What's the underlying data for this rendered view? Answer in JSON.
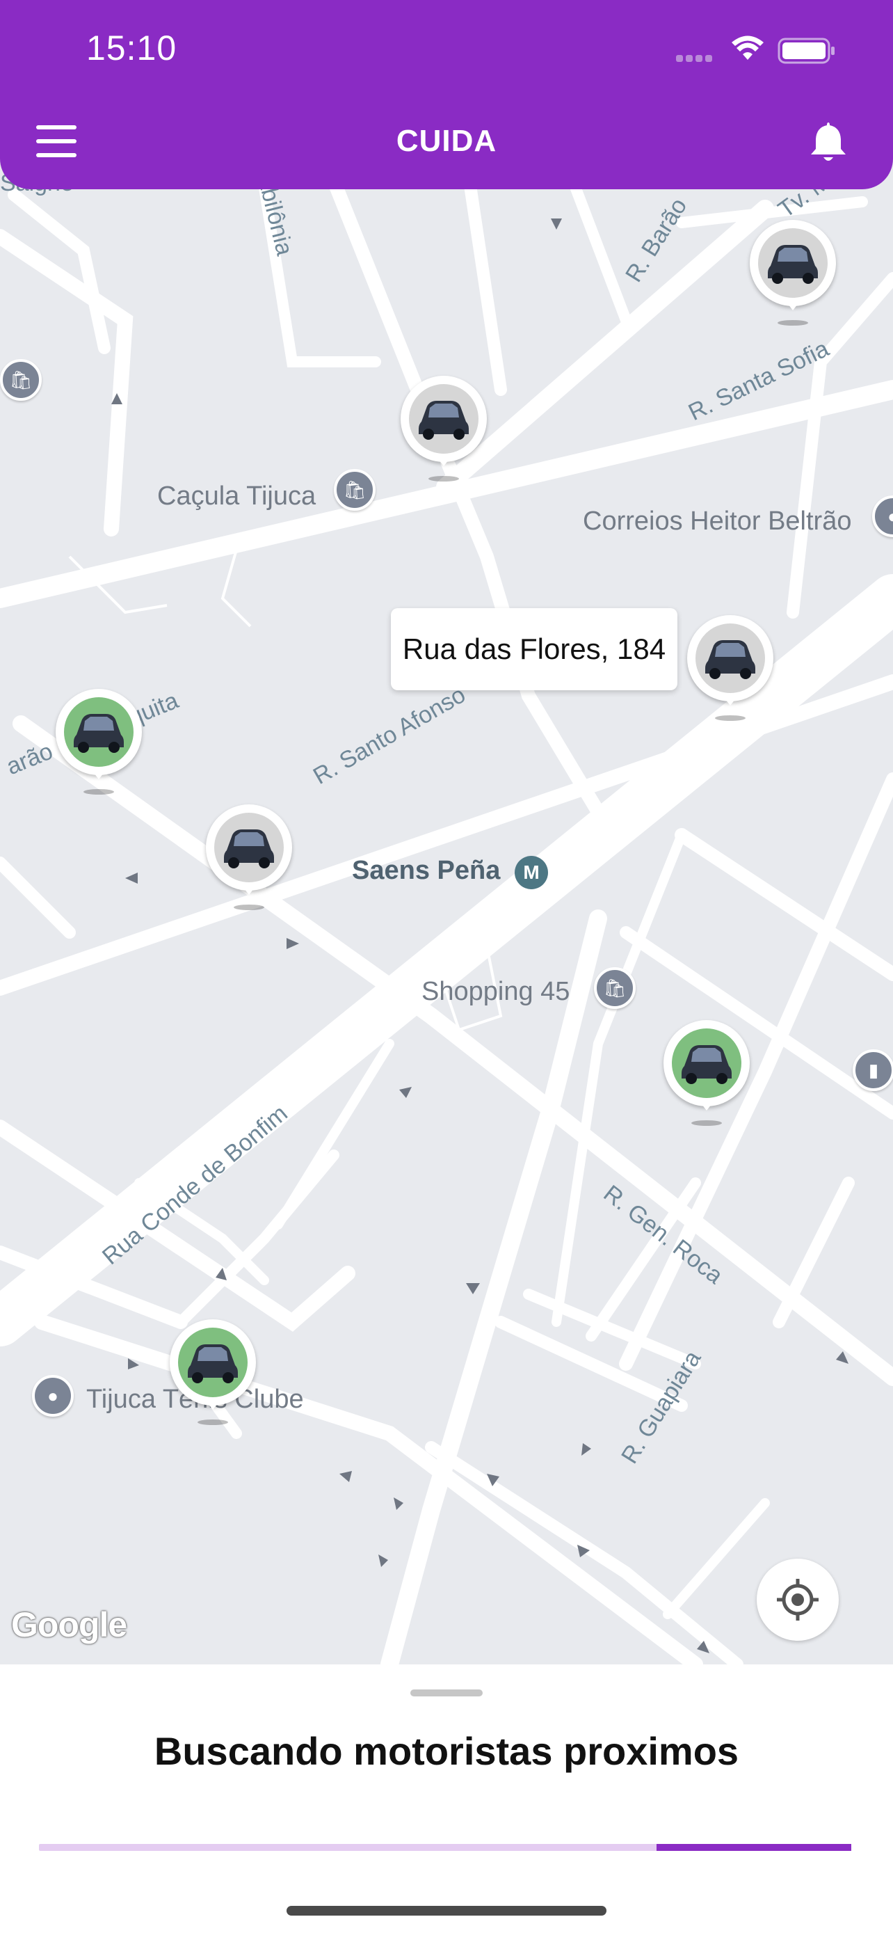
{
  "status_bar": {
    "time": "15:10"
  },
  "header": {
    "title": "CUIDA"
  },
  "map": {
    "poi_labels": [
      {
        "text": "Caçula Tijuca"
      },
      {
        "text": "Correios Heitor Beltrão"
      },
      {
        "text": "Saens Peña"
      },
      {
        "text": "Shopping 45"
      },
      {
        "text": "Tijuca Tênis Clube"
      }
    ],
    "street_labels": [
      {
        "text": "Saigne"
      },
      {
        "text": "abilônia"
      },
      {
        "text": "R. Barão"
      },
      {
        "text": "R. Santa Sofia"
      },
      {
        "text": "arão de Mesquita"
      },
      {
        "text": "R. Santo Afonso"
      },
      {
        "text": "Rua Conde de Bonfim"
      },
      {
        "text": "R. Gen. Roca"
      },
      {
        "text": "R. Guapiara"
      },
      {
        "text": "Tv. M"
      }
    ],
    "address_callout": "Rua das Flores, 184",
    "attribution": "Google",
    "colors": {
      "driver_busy": "#d6d6d6",
      "driver_available": "#7fbf7f"
    }
  },
  "sheet": {
    "title": "Buscando motoristas proximos",
    "progress": 0.76
  },
  "colors": {
    "accent": "#8a2bc4",
    "accent_light": "#e4ccf1"
  }
}
